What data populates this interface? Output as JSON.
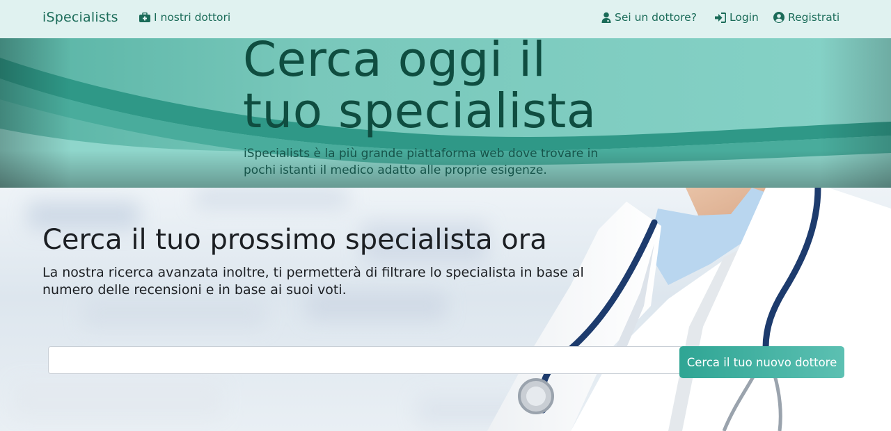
{
  "navbar": {
    "brand": "iSpecialists",
    "links": [
      {
        "label": "I nostri dottori",
        "icon": "medical-kit-icon"
      },
      {
        "label": "Sei un dottore?",
        "icon": "user-doctor-icon"
      },
      {
        "label": "Login",
        "icon": "sign-in-icon"
      },
      {
        "label": "Registrati",
        "icon": "user-circle-icon"
      }
    ]
  },
  "hero": {
    "title_line1": "Cerca oggi il",
    "title_line2": "tuo specialista",
    "subtitle": "iSpecialists è la più grande piattaforma web dove trovare in pochi istanti il medico adatto alle proprie esigenze."
  },
  "search": {
    "title": "Cerca il tuo prossimo specialista ora",
    "description": "La nostra ricerca avanzata inoltre, ti permetterà di filtrare lo specialista in base al numero delle recensioni e in base ai suoi voti.",
    "input_value": "",
    "button_label": "Cerca il tuo nuovo dottore"
  },
  "colors": {
    "brand": "#1a6b58",
    "navbar_bg": "#e0f2f0",
    "hero_teal": "#7fcdc1",
    "button_teal": "#2fa594"
  }
}
